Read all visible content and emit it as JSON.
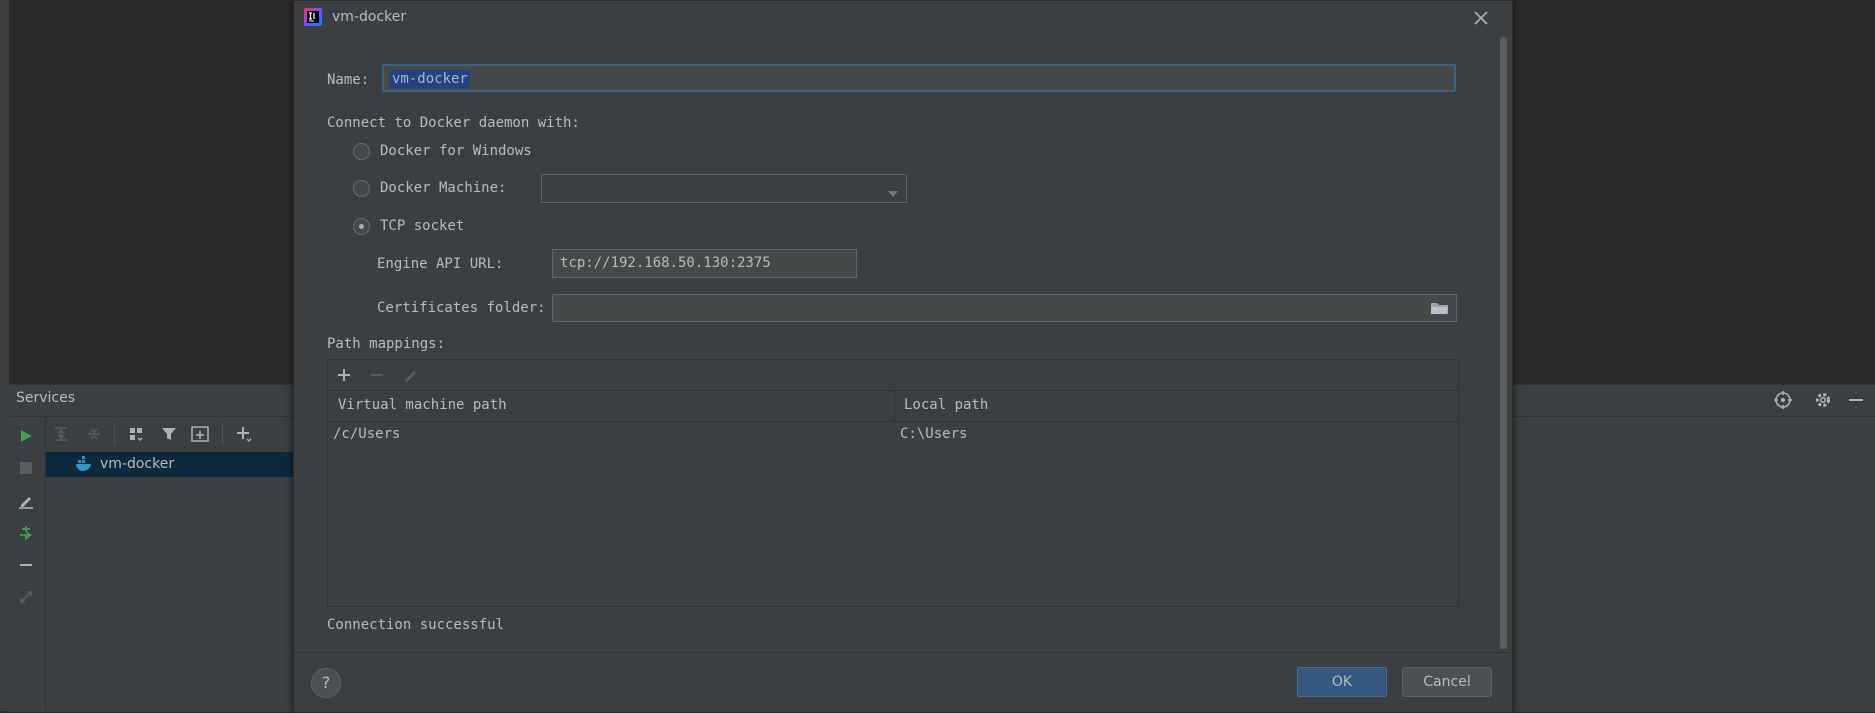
{
  "dialog": {
    "title": "vm-docker",
    "name_label": "Name:",
    "name_value": "vm-docker",
    "connect_label": "Connect to Docker daemon with:",
    "options": {
      "windows": "Docker for Windows",
      "machine": "Docker Machine:",
      "tcp": "TCP socket"
    },
    "selected_option": "tcp",
    "machine_value": "",
    "engine_api_label": "Engine API URL:",
    "engine_api_value": "tcp://192.168.50.130:2375",
    "certificates_label": "Certificates folder:",
    "certificates_value": "",
    "path_mappings_label": "Path mappings:",
    "table": {
      "columns": [
        "Virtual machine path",
        "Local path"
      ],
      "rows": [
        [
          "/c/Users",
          "C:\\Users"
        ]
      ]
    },
    "status": "Connection successful",
    "help_label": "?",
    "ok_label": "OK",
    "cancel_label": "Cancel"
  },
  "services": {
    "title": "Services",
    "tree_items": [
      "vm-docker"
    ]
  },
  "colors": {
    "accent_blue": "#365880",
    "selection": "#214283",
    "run_green": "#499c54",
    "bg_panel": "#3c3f41"
  }
}
